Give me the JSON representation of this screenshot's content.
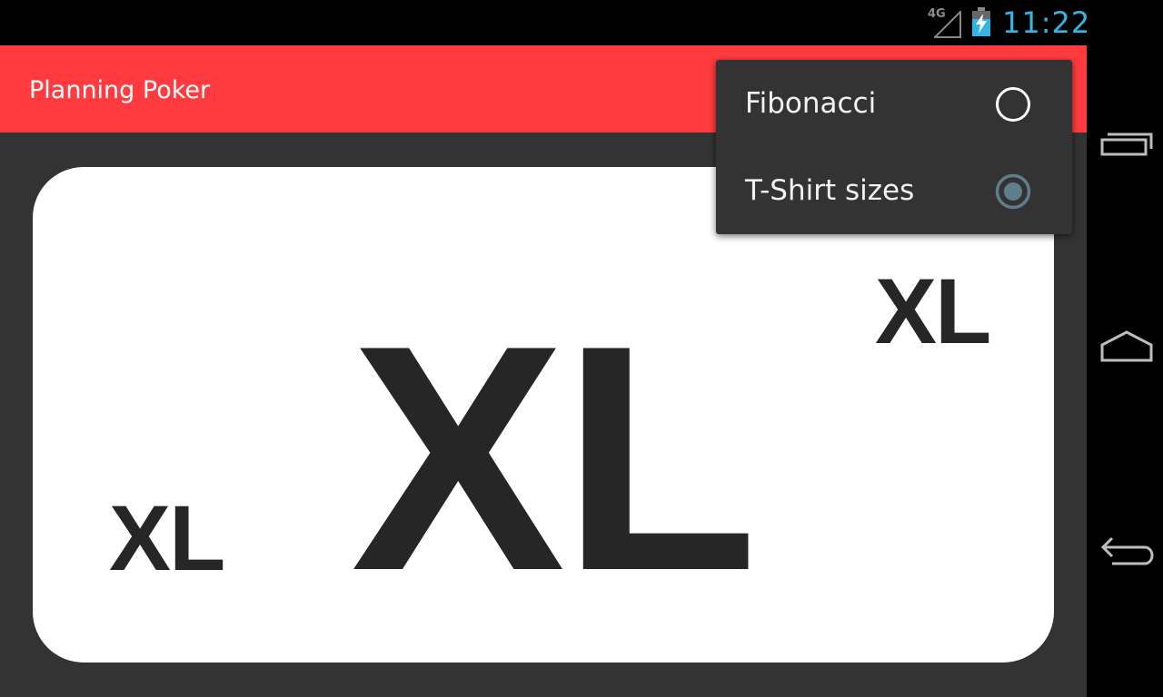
{
  "status_bar": {
    "network_label": "4G",
    "clock": "11:22",
    "accent_color": "#33b5e5"
  },
  "app_bar": {
    "title": "Planning Poker",
    "color": "#ff3b3f"
  },
  "card": {
    "value_center": "XL",
    "value_corner_top": "XL",
    "value_corner_bottom": "XL"
  },
  "menu": {
    "items": [
      {
        "label": "Fibonacci",
        "checked": false
      },
      {
        "label": "T-Shirt sizes",
        "checked": true
      }
    ]
  },
  "nav_bar": {
    "buttons": [
      "recent-apps-icon",
      "home-icon",
      "back-icon"
    ]
  }
}
